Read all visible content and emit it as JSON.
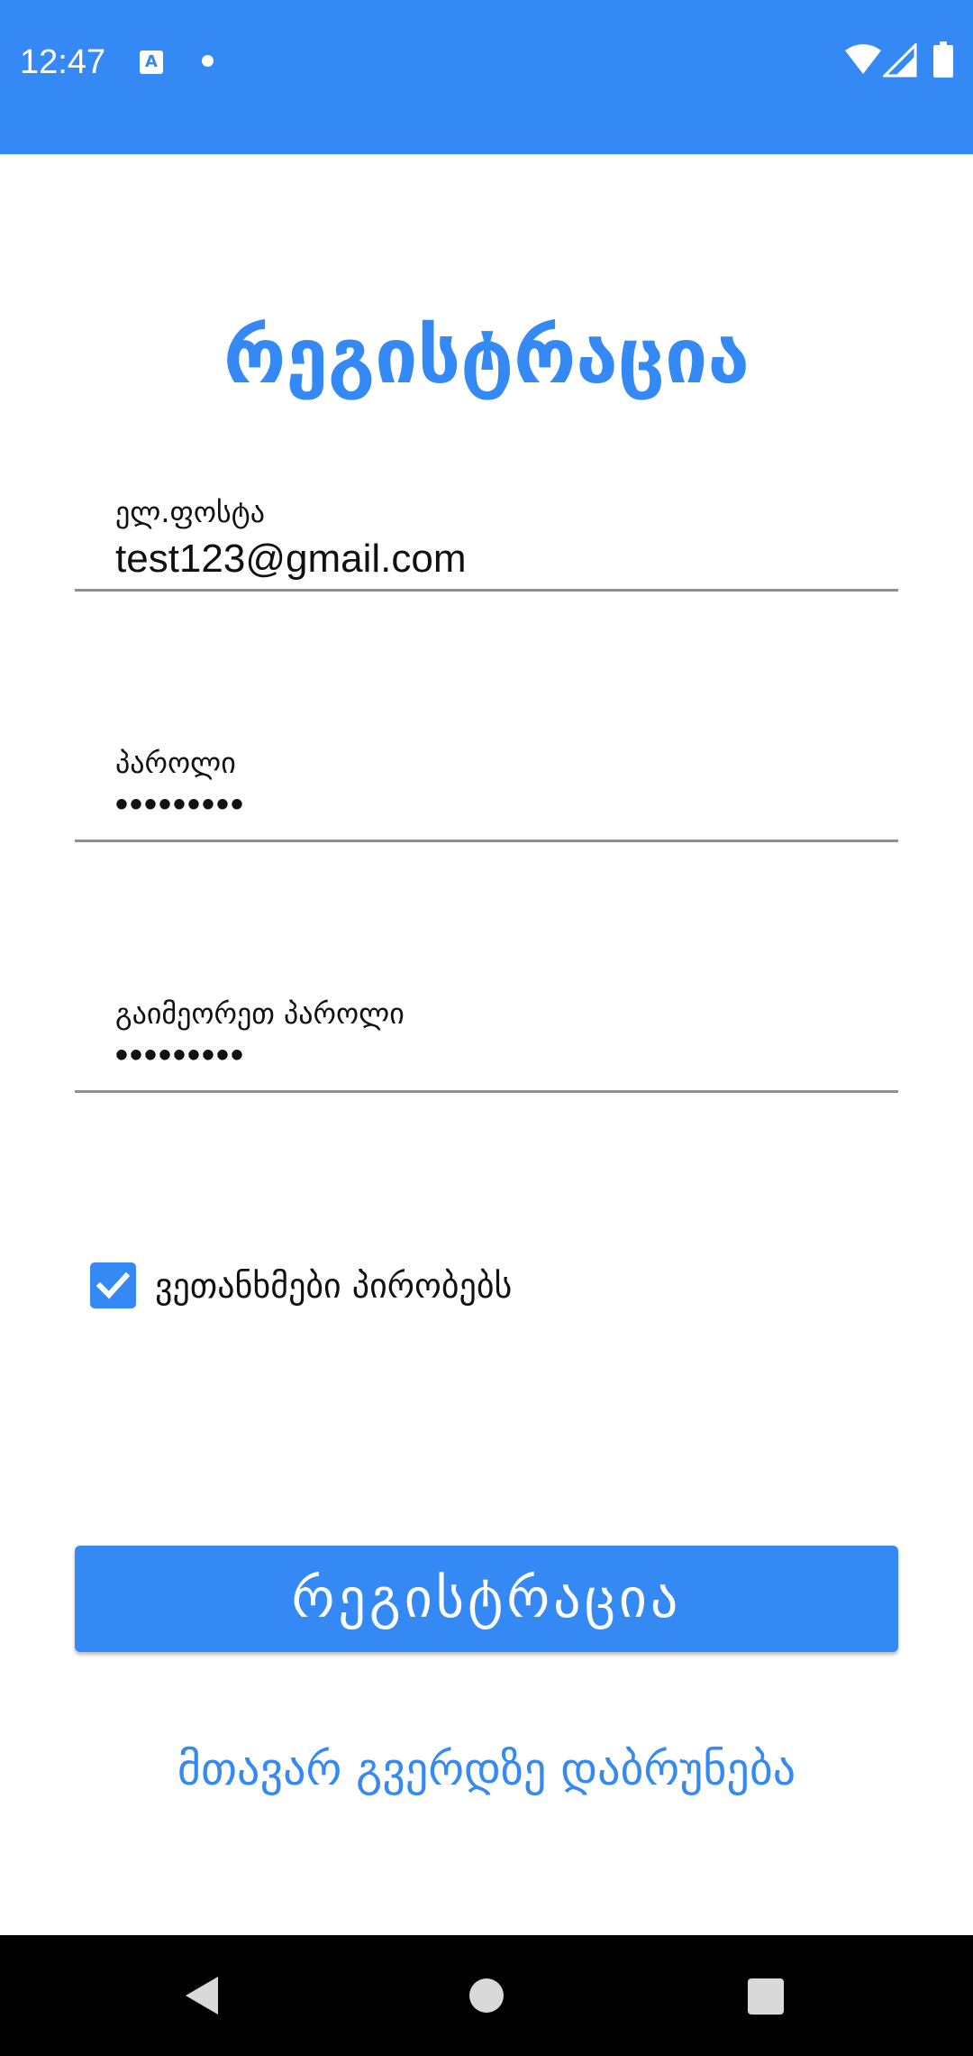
{
  "status_bar": {
    "time": "12:47",
    "app_icon_letter": "A",
    "icons": [
      "a-notification-icon",
      "dot-icon",
      "wifi-icon",
      "signal-icon",
      "battery-icon"
    ]
  },
  "page": {
    "title": "რეგისტრაცია"
  },
  "form": {
    "email": {
      "label": "ელ.ფოსტა",
      "value": "test123@gmail.com"
    },
    "password": {
      "label": "პაროლი",
      "value": "•••••••••"
    },
    "repeat_password": {
      "label": "გაიმეორეთ პაროლი",
      "value": "•••••••••"
    },
    "terms": {
      "label": "ვეთანხმები პირობებს",
      "checked": true
    }
  },
  "actions": {
    "register_label": "რეგისტრაცია",
    "back_link_label": "მთავარ გვერდზე დაბრუნება"
  },
  "colors": {
    "accent": "#3489f5",
    "navbar": "#000000",
    "divider": "#8e8e8e"
  },
  "nav_bar": {
    "icons": [
      "back-icon",
      "home-icon",
      "recents-icon"
    ]
  }
}
